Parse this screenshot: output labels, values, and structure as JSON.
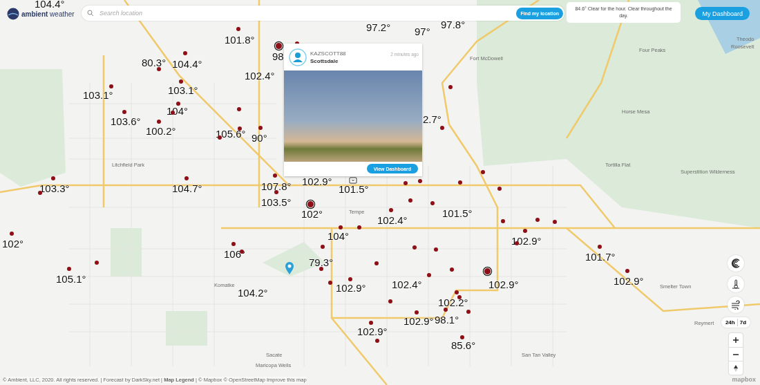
{
  "header": {
    "logo": "**ambient** weather",
    "search": {
      "placeholder": "Search location",
      "button": "Find my location"
    },
    "forecast": "84.6° Clear for the hour. Clear throughout the day.",
    "dashboard_button": "My Dashboard"
  },
  "popup": {
    "username": "KAZSCOTT88",
    "location": "Scottsdale",
    "time": "2 minutes ago",
    "button": "View Dashboard"
  },
  "map": {
    "temperatures": [
      "104.4°",
      "97.2°",
      "97°",
      "97.8°",
      "101.8°",
      "98",
      "80.3°",
      "104.4°",
      "102.4°",
      "103.1°",
      "103.1°",
      "104°",
      "103.6°",
      "100.2°",
      "105.6°",
      "90°",
      "2.7°",
      "103.3°",
      "104.7°",
      "107.8°",
      "102.9°",
      "101.5°",
      "103.5°",
      "102°",
      "102.4°",
      "101.5°",
      "104°",
      "102.9°",
      "102°",
      "106°",
      "101.7°",
      "79.3°",
      "105.1°",
      "102.4°",
      "102.9°",
      "102.9°",
      "102.9°",
      "104.2°",
      "102.2°",
      "102.9°",
      "98.1°",
      "102.9°",
      "85.6°"
    ],
    "places": [
      "Four Peaks",
      "Fort McDowell",
      "Horse Mesa",
      "Tortilla Flat",
      "Superstition Wilderness",
      "Litchfield Park",
      "Tempe",
      "Komatke",
      "Smelter Town",
      "Reymert",
      "Sacate",
      "Maricopa Wells",
      "San Tan Valley",
      "Theodo",
      "Roosevelt"
    ]
  },
  "controls": {
    "ranges": [
      "24h",
      "7d"
    ]
  },
  "footer": {
    "attribution": "© Ambient, LLC, 2020. All rights reserved. | Forecast by DarkSky.net | **Map Legend** | © Mapbox © OpenStreetMap  Improve this map",
    "mapbox": "mapbox"
  }
}
